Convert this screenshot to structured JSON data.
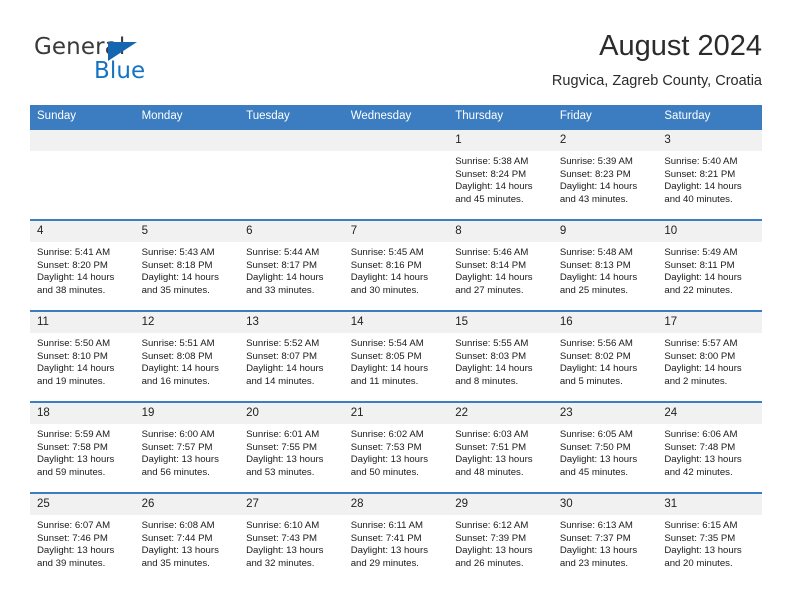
{
  "logo": {
    "word_top": "General",
    "word_bottom": "Blue",
    "triangle_icon": "blue-triangle-icon",
    "color_text": "#3a3a3a",
    "color_blue": "#1573c6"
  },
  "header": {
    "title": "August 2024",
    "subtitle": "Rugvica, Zagreb County, Croatia"
  },
  "theme": {
    "header_bg": "#3b7dc0",
    "header_text": "#ffffff",
    "daynum_bg": "#f1f1f1",
    "row_border": "#3b7dc0"
  },
  "weekday_headers": [
    "Sunday",
    "Monday",
    "Tuesday",
    "Wednesday",
    "Thursday",
    "Friday",
    "Saturday"
  ],
  "weeks": [
    [
      {
        "day": "",
        "empty": true,
        "lines": []
      },
      {
        "day": "",
        "empty": true,
        "lines": []
      },
      {
        "day": "",
        "empty": true,
        "lines": []
      },
      {
        "day": "",
        "empty": true,
        "lines": []
      },
      {
        "day": "1",
        "empty": false,
        "lines": [
          "Sunrise: 5:38 AM",
          "Sunset: 8:24 PM",
          "Daylight: 14 hours",
          "and 45 minutes."
        ]
      },
      {
        "day": "2",
        "empty": false,
        "lines": [
          "Sunrise: 5:39 AM",
          "Sunset: 8:23 PM",
          "Daylight: 14 hours",
          "and 43 minutes."
        ]
      },
      {
        "day": "3",
        "empty": false,
        "lines": [
          "Sunrise: 5:40 AM",
          "Sunset: 8:21 PM",
          "Daylight: 14 hours",
          "and 40 minutes."
        ]
      }
    ],
    [
      {
        "day": "4",
        "empty": false,
        "lines": [
          "Sunrise: 5:41 AM",
          "Sunset: 8:20 PM",
          "Daylight: 14 hours",
          "and 38 minutes."
        ]
      },
      {
        "day": "5",
        "empty": false,
        "lines": [
          "Sunrise: 5:43 AM",
          "Sunset: 8:18 PM",
          "Daylight: 14 hours",
          "and 35 minutes."
        ]
      },
      {
        "day": "6",
        "empty": false,
        "lines": [
          "Sunrise: 5:44 AM",
          "Sunset: 8:17 PM",
          "Daylight: 14 hours",
          "and 33 minutes."
        ]
      },
      {
        "day": "7",
        "empty": false,
        "lines": [
          "Sunrise: 5:45 AM",
          "Sunset: 8:16 PM",
          "Daylight: 14 hours",
          "and 30 minutes."
        ]
      },
      {
        "day": "8",
        "empty": false,
        "lines": [
          "Sunrise: 5:46 AM",
          "Sunset: 8:14 PM",
          "Daylight: 14 hours",
          "and 27 minutes."
        ]
      },
      {
        "day": "9",
        "empty": false,
        "lines": [
          "Sunrise: 5:48 AM",
          "Sunset: 8:13 PM",
          "Daylight: 14 hours",
          "and 25 minutes."
        ]
      },
      {
        "day": "10",
        "empty": false,
        "lines": [
          "Sunrise: 5:49 AM",
          "Sunset: 8:11 PM",
          "Daylight: 14 hours",
          "and 22 minutes."
        ]
      }
    ],
    [
      {
        "day": "11",
        "empty": false,
        "lines": [
          "Sunrise: 5:50 AM",
          "Sunset: 8:10 PM",
          "Daylight: 14 hours",
          "and 19 minutes."
        ]
      },
      {
        "day": "12",
        "empty": false,
        "lines": [
          "Sunrise: 5:51 AM",
          "Sunset: 8:08 PM",
          "Daylight: 14 hours",
          "and 16 minutes."
        ]
      },
      {
        "day": "13",
        "empty": false,
        "lines": [
          "Sunrise: 5:52 AM",
          "Sunset: 8:07 PM",
          "Daylight: 14 hours",
          "and 14 minutes."
        ]
      },
      {
        "day": "14",
        "empty": false,
        "lines": [
          "Sunrise: 5:54 AM",
          "Sunset: 8:05 PM",
          "Daylight: 14 hours",
          "and 11 minutes."
        ]
      },
      {
        "day": "15",
        "empty": false,
        "lines": [
          "Sunrise: 5:55 AM",
          "Sunset: 8:03 PM",
          "Daylight: 14 hours",
          "and 8 minutes."
        ]
      },
      {
        "day": "16",
        "empty": false,
        "lines": [
          "Sunrise: 5:56 AM",
          "Sunset: 8:02 PM",
          "Daylight: 14 hours",
          "and 5 minutes."
        ]
      },
      {
        "day": "17",
        "empty": false,
        "lines": [
          "Sunrise: 5:57 AM",
          "Sunset: 8:00 PM",
          "Daylight: 14 hours",
          "and 2 minutes."
        ]
      }
    ],
    [
      {
        "day": "18",
        "empty": false,
        "lines": [
          "Sunrise: 5:59 AM",
          "Sunset: 7:58 PM",
          "Daylight: 13 hours",
          "and 59 minutes."
        ]
      },
      {
        "day": "19",
        "empty": false,
        "lines": [
          "Sunrise: 6:00 AM",
          "Sunset: 7:57 PM",
          "Daylight: 13 hours",
          "and 56 minutes."
        ]
      },
      {
        "day": "20",
        "empty": false,
        "lines": [
          "Sunrise: 6:01 AM",
          "Sunset: 7:55 PM",
          "Daylight: 13 hours",
          "and 53 minutes."
        ]
      },
      {
        "day": "21",
        "empty": false,
        "lines": [
          "Sunrise: 6:02 AM",
          "Sunset: 7:53 PM",
          "Daylight: 13 hours",
          "and 50 minutes."
        ]
      },
      {
        "day": "22",
        "empty": false,
        "lines": [
          "Sunrise: 6:03 AM",
          "Sunset: 7:51 PM",
          "Daylight: 13 hours",
          "and 48 minutes."
        ]
      },
      {
        "day": "23",
        "empty": false,
        "lines": [
          "Sunrise: 6:05 AM",
          "Sunset: 7:50 PM",
          "Daylight: 13 hours",
          "and 45 minutes."
        ]
      },
      {
        "day": "24",
        "empty": false,
        "lines": [
          "Sunrise: 6:06 AM",
          "Sunset: 7:48 PM",
          "Daylight: 13 hours",
          "and 42 minutes."
        ]
      }
    ],
    [
      {
        "day": "25",
        "empty": false,
        "lines": [
          "Sunrise: 6:07 AM",
          "Sunset: 7:46 PM",
          "Daylight: 13 hours",
          "and 39 minutes."
        ]
      },
      {
        "day": "26",
        "empty": false,
        "lines": [
          "Sunrise: 6:08 AM",
          "Sunset: 7:44 PM",
          "Daylight: 13 hours",
          "and 35 minutes."
        ]
      },
      {
        "day": "27",
        "empty": false,
        "lines": [
          "Sunrise: 6:10 AM",
          "Sunset: 7:43 PM",
          "Daylight: 13 hours",
          "and 32 minutes."
        ]
      },
      {
        "day": "28",
        "empty": false,
        "lines": [
          "Sunrise: 6:11 AM",
          "Sunset: 7:41 PM",
          "Daylight: 13 hours",
          "and 29 minutes."
        ]
      },
      {
        "day": "29",
        "empty": false,
        "lines": [
          "Sunrise: 6:12 AM",
          "Sunset: 7:39 PM",
          "Daylight: 13 hours",
          "and 26 minutes."
        ]
      },
      {
        "day": "30",
        "empty": false,
        "lines": [
          "Sunrise: 6:13 AM",
          "Sunset: 7:37 PM",
          "Daylight: 13 hours",
          "and 23 minutes."
        ]
      },
      {
        "day": "31",
        "empty": false,
        "lines": [
          "Sunrise: 6:15 AM",
          "Sunset: 7:35 PM",
          "Daylight: 13 hours",
          "and 20 minutes."
        ]
      }
    ]
  ]
}
